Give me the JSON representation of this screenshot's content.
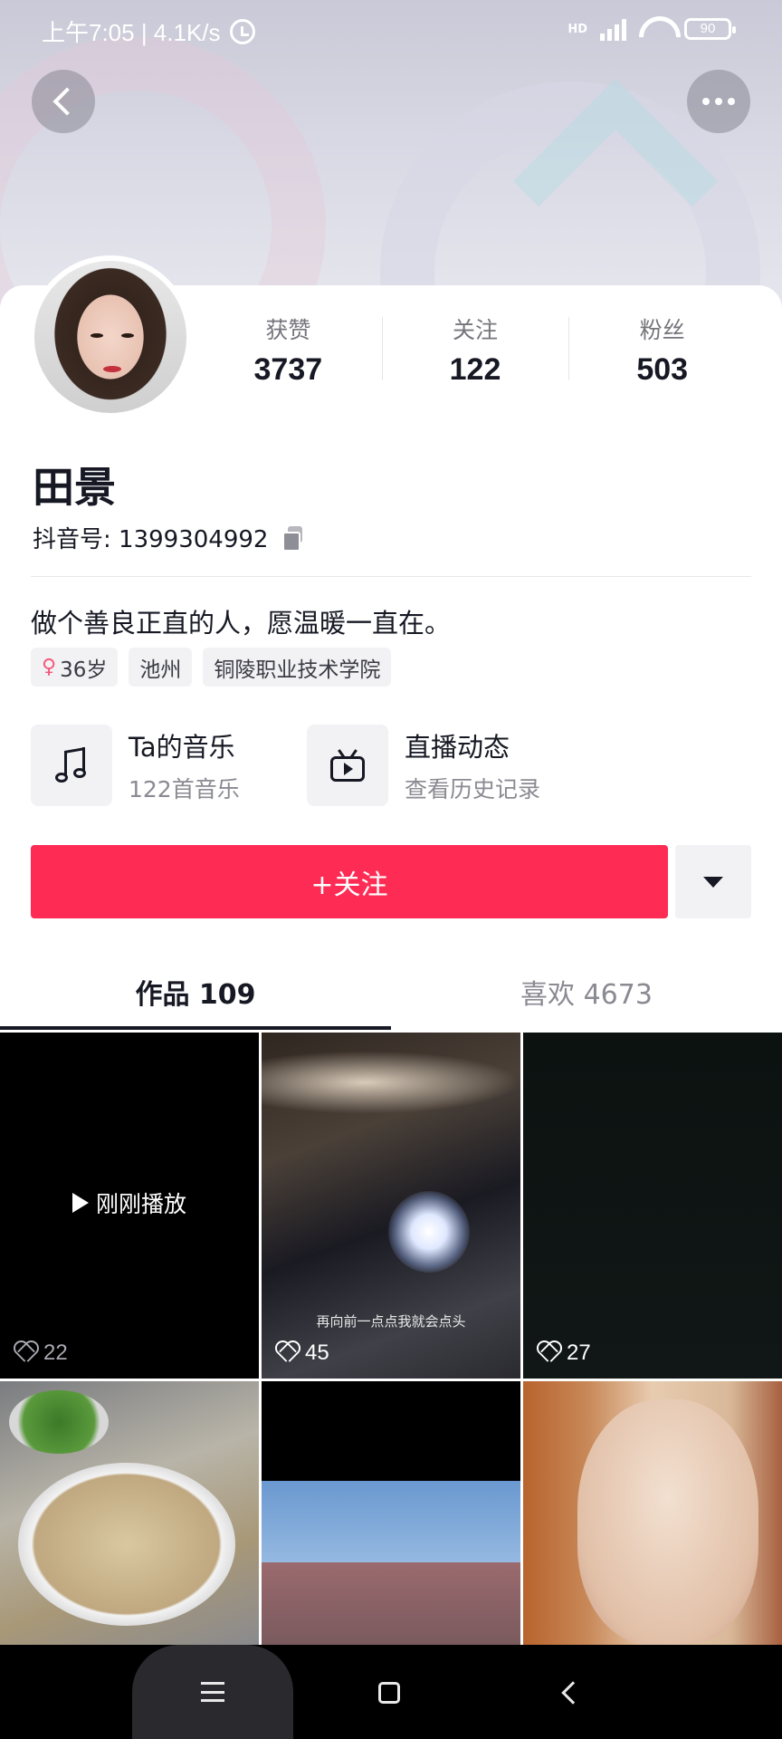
{
  "status_bar": {
    "time_speed": "上午7:05 | 4.1K/s",
    "network": "HD",
    "battery": "90"
  },
  "profile": {
    "name": "田景",
    "douyin_id": "抖音号: 1399304992",
    "bio": "做个善良正直的人，愿温暖一直在。",
    "stats": [
      {
        "label": "获赞",
        "value": "3737"
      },
      {
        "label": "关注",
        "value": "122"
      },
      {
        "label": "粉丝",
        "value": "503"
      }
    ],
    "tags": [
      {
        "label": "36岁",
        "icon": "female-icon",
        "symbol": "♀"
      },
      {
        "label": "池州"
      },
      {
        "label": "铜陵职业技术学院"
      }
    ]
  },
  "entries": [
    {
      "title": "Ta的音乐",
      "subtitle": "122首音乐",
      "icon": "music-note-icon"
    },
    {
      "title": "直播动态",
      "subtitle": "查看历史记录",
      "icon": "live-tv-icon"
    }
  ],
  "actions": {
    "follow_label": "+关注"
  },
  "tabs": [
    {
      "label": "作品 109",
      "active": true
    },
    {
      "label": "喜欢 4673",
      "active": false
    }
  ],
  "videos": [
    {
      "overlay": "刚刚播放",
      "likes": "22"
    },
    {
      "caption": "再向前一点点我就会点头",
      "likes": "45"
    },
    {
      "likes": "27"
    },
    {},
    {},
    {}
  ],
  "colors": {
    "accent": "#fe2c55",
    "text": "#161823",
    "muted": "#8a8a92"
  }
}
